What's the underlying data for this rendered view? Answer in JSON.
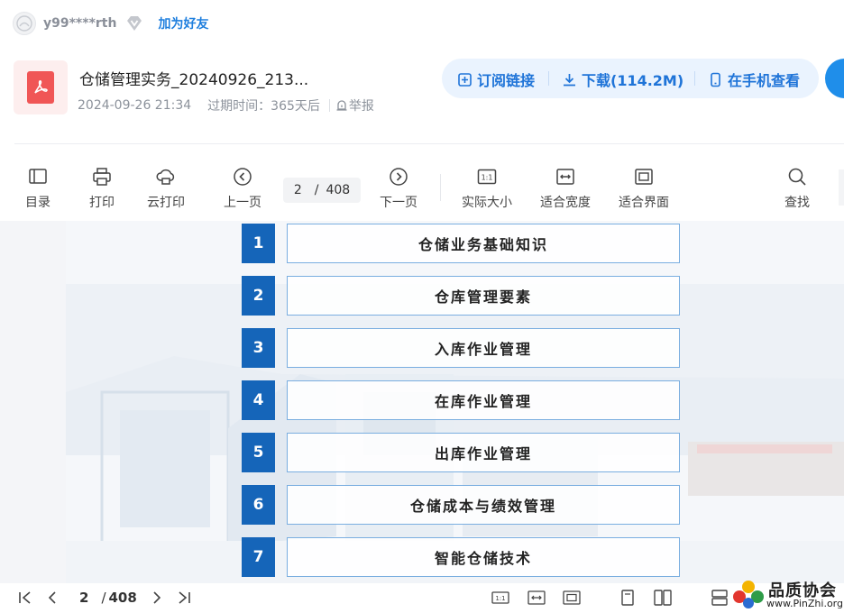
{
  "user": {
    "name": "y99****rth",
    "add_friend": "加为好友"
  },
  "file": {
    "title": "仓储管理实务_20240926_213...",
    "date": "2024-09-26 21:34",
    "expire": "过期时间：365天后",
    "report": "举报",
    "icon": "pdf-icon"
  },
  "actions": {
    "subscribe": "订阅链接",
    "download": "下载(114.2M)",
    "phone": "在手机查看"
  },
  "toolbar": {
    "toc": "目录",
    "print": "打印",
    "cloud_print": "云打印",
    "prev": "上一页",
    "current_page": "2",
    "total_pages": "408",
    "next": "下一页",
    "actual_size_icon_text": "1:1",
    "actual_size": "实际大小",
    "fit_width": "适合宽度",
    "fit_page": "适合界面",
    "search": "查找"
  },
  "toc_items": [
    {
      "num": "1",
      "text": "仓储业务基础知识"
    },
    {
      "num": "2",
      "text": "仓库管理要素"
    },
    {
      "num": "3",
      "text": "入库作业管理"
    },
    {
      "num": "4",
      "text": "在库作业管理"
    },
    {
      "num": "5",
      "text": "出库作业管理"
    },
    {
      "num": "6",
      "text": "仓储成本与绩效管理"
    },
    {
      "num": "7",
      "text": "智能仓储技术"
    }
  ],
  "bottom": {
    "page": "2",
    "total": "408",
    "actual_icon_text": "1:1"
  },
  "watermark": {
    "title": "品质协会",
    "url": "www.PinZhi.org"
  },
  "colors": {
    "accent": "#1f74d8",
    "toc_num_bg": "#1565b9",
    "pill_bg": "#eaf3fe"
  }
}
